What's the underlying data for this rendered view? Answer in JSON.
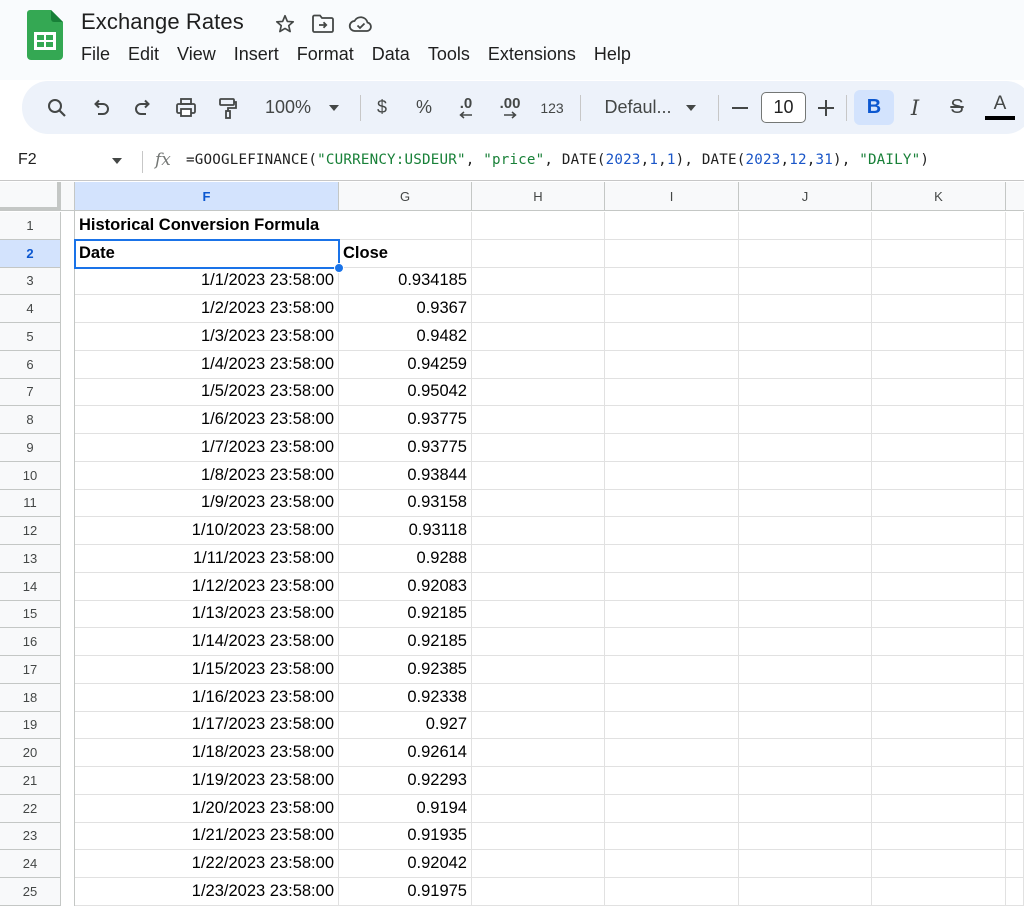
{
  "title_bar": {
    "doc_title": "Exchange Rates",
    "icons": [
      "star-icon",
      "move-folder-icon",
      "cloud-status-icon"
    ]
  },
  "menu": [
    "File",
    "Edit",
    "View",
    "Insert",
    "Format",
    "Data",
    "Tools",
    "Extensions",
    "Help"
  ],
  "toolbar": {
    "zoom": "100%",
    "currency": "$",
    "percent": "%",
    "decrease_decimal": ".0",
    "increase_decimal": ".00",
    "number_format": "123",
    "font": "Defaul...",
    "font_size": "10",
    "bold": "B",
    "italic": "I",
    "strike": "S",
    "text_color": "A",
    "colors": {
      "accent": "#0b57d0",
      "toolbar_bg": "#edf2fa",
      "active_bg": "#d3e3fd"
    }
  },
  "formula_bar": {
    "cell_ref": "F2",
    "fx": "fx",
    "formula_parts": [
      {
        "t": "=GOOGLEFINANCE(",
        "c": "plain"
      },
      {
        "t": "\"CURRENCY:USDEUR\"",
        "c": "str"
      },
      {
        "t": ", ",
        "c": "plain"
      },
      {
        "t": "\"price\"",
        "c": "str"
      },
      {
        "t": ", DATE(",
        "c": "plain"
      },
      {
        "t": "2023",
        "c": "num"
      },
      {
        "t": ",",
        "c": "plain"
      },
      {
        "t": "1",
        "c": "num"
      },
      {
        "t": ",",
        "c": "plain"
      },
      {
        "t": "1",
        "c": "num"
      },
      {
        "t": "), DATE(",
        "c": "plain"
      },
      {
        "t": "2023",
        "c": "num"
      },
      {
        "t": ",",
        "c": "plain"
      },
      {
        "t": "12",
        "c": "num"
      },
      {
        "t": ",",
        "c": "plain"
      },
      {
        "t": "31",
        "c": "num"
      },
      {
        "t": "), ",
        "c": "plain"
      },
      {
        "t": "\"DAILY\"",
        "c": "str"
      },
      {
        "t": ")",
        "c": "plain"
      }
    ]
  },
  "sheet": {
    "columns": [
      "F",
      "G",
      "H",
      "I",
      "J",
      "K"
    ],
    "active_column": "F",
    "active_row": 2,
    "rows": [
      {
        "n": "1",
        "f": "Historical Conversion Formula",
        "g": "",
        "style": "bold"
      },
      {
        "n": "2",
        "f": "Date",
        "g": "Close",
        "style": "bold"
      },
      {
        "n": "3",
        "f": "1/1/2023 23:58:00",
        "g": "0.934185"
      },
      {
        "n": "4",
        "f": "1/2/2023 23:58:00",
        "g": "0.9367"
      },
      {
        "n": "5",
        "f": "1/3/2023 23:58:00",
        "g": "0.9482"
      },
      {
        "n": "6",
        "f": "1/4/2023 23:58:00",
        "g": "0.94259"
      },
      {
        "n": "7",
        "f": "1/5/2023 23:58:00",
        "g": "0.95042"
      },
      {
        "n": "8",
        "f": "1/6/2023 23:58:00",
        "g": "0.93775"
      },
      {
        "n": "9",
        "f": "1/7/2023 23:58:00",
        "g": "0.93775"
      },
      {
        "n": "10",
        "f": "1/8/2023 23:58:00",
        "g": "0.93844"
      },
      {
        "n": "11",
        "f": "1/9/2023 23:58:00",
        "g": "0.93158"
      },
      {
        "n": "12",
        "f": "1/10/2023 23:58:00",
        "g": "0.93118"
      },
      {
        "n": "13",
        "f": "1/11/2023 23:58:00",
        "g": "0.9288"
      },
      {
        "n": "14",
        "f": "1/12/2023 23:58:00",
        "g": "0.92083"
      },
      {
        "n": "15",
        "f": "1/13/2023 23:58:00",
        "g": "0.92185"
      },
      {
        "n": "16",
        "f": "1/14/2023 23:58:00",
        "g": "0.92185"
      },
      {
        "n": "17",
        "f": "1/15/2023 23:58:00",
        "g": "0.92385"
      },
      {
        "n": "18",
        "f": "1/16/2023 23:58:00",
        "g": "0.92338"
      },
      {
        "n": "19",
        "f": "1/17/2023 23:58:00",
        "g": "0.927"
      },
      {
        "n": "20",
        "f": "1/18/2023 23:58:00",
        "g": "0.92614"
      },
      {
        "n": "21",
        "f": "1/19/2023 23:58:00",
        "g": "0.92293"
      },
      {
        "n": "22",
        "f": "1/20/2023 23:58:00",
        "g": "0.9194"
      },
      {
        "n": "23",
        "f": "1/21/2023 23:58:00",
        "g": "0.91935"
      },
      {
        "n": "24",
        "f": "1/22/2023 23:58:00",
        "g": "0.92042"
      },
      {
        "n": "25",
        "f": "1/23/2023 23:58:00",
        "g": "0.91975"
      }
    ]
  }
}
